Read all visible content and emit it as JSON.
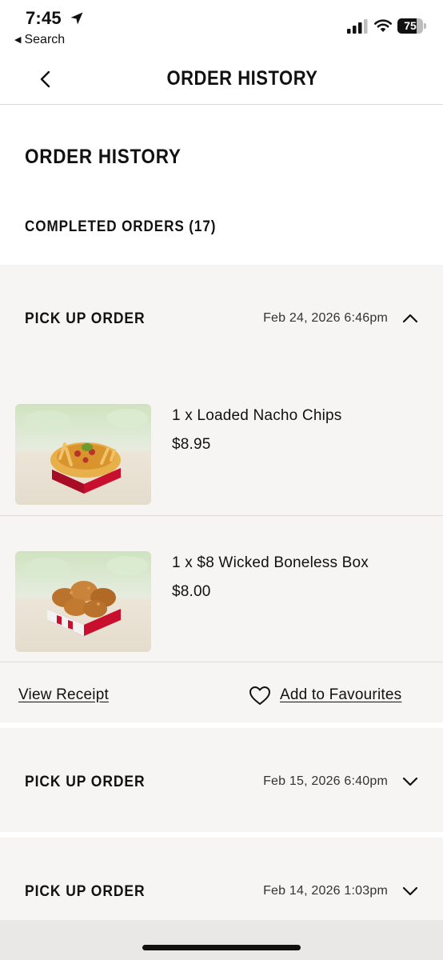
{
  "status_bar": {
    "time": "7:45",
    "back_label": "Search",
    "battery": "75"
  },
  "nav": {
    "title": "ORDER HISTORY"
  },
  "page": {
    "title": "ORDER HISTORY",
    "section_title": "COMPLETED ORDERS (17)"
  },
  "orders": [
    {
      "type": "PICK UP ORDER",
      "date": "Feb 24, 2026 6:46pm",
      "expanded": true,
      "items": [
        {
          "name": "1 x Loaded Nacho Chips",
          "price": "$8.95"
        },
        {
          "name": "1 x $8 Wicked Boneless Box",
          "price": "$8.00"
        }
      ],
      "view_receipt": "View Receipt",
      "add_favourites": "Add to Favourites"
    },
    {
      "type": "PICK UP ORDER",
      "date": "Feb 15, 2026 6:40pm",
      "expanded": false
    },
    {
      "type": "PICK UP ORDER",
      "date": "Feb 14, 2026 1:03pm",
      "expanded": false
    }
  ]
}
